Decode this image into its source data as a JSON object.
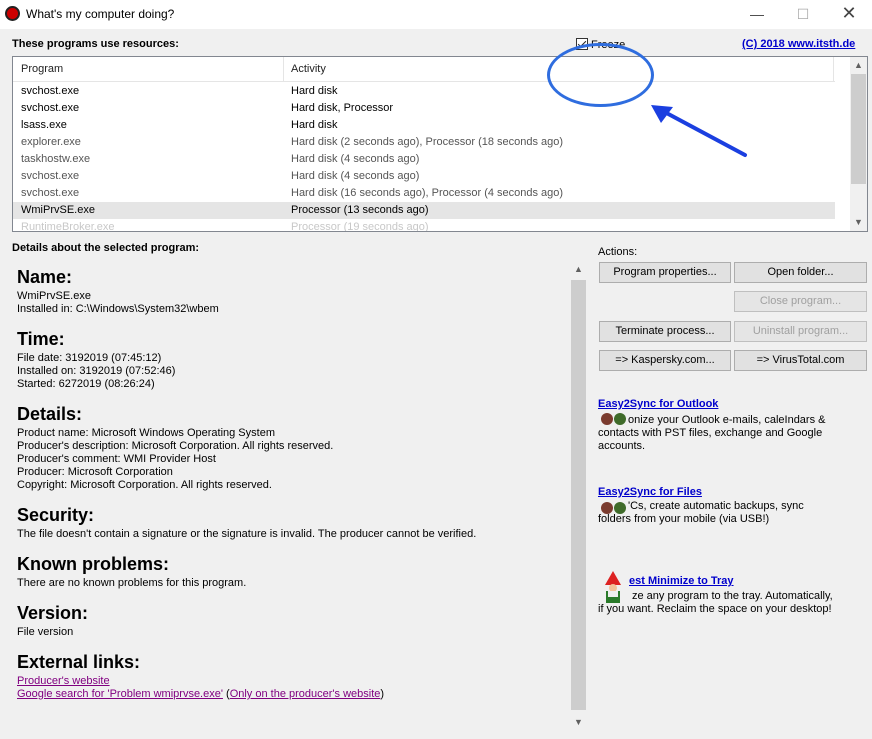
{
  "window": {
    "title": "What's my computer doing?",
    "minimize_glyph": "—",
    "maximize_glyph": "☐",
    "close_glyph": "✕"
  },
  "top": {
    "programs_label": "These programs use resources:",
    "freeze_label": "Freeze",
    "freeze_checked": true,
    "copyright": "(C) 2018 www.itsth.de"
  },
  "list": {
    "columns": [
      "Program",
      "Activity"
    ],
    "rows": [
      {
        "program": "svchost.exe",
        "activity": "Hard disk"
      },
      {
        "program": "svchost.exe",
        "activity": "Hard disk, Processor"
      },
      {
        "program": "lsass.exe",
        "activity": "Hard disk"
      },
      {
        "program": "explorer.exe",
        "activity": "Hard disk (2 seconds ago), Processor (18 seconds ago)"
      },
      {
        "program": "taskhostw.exe",
        "activity": "Hard disk (4 seconds ago)"
      },
      {
        "program": "svchost.exe",
        "activity": "Hard disk (4 seconds ago)"
      },
      {
        "program": "svchost.exe",
        "activity": "Hard disk (16 seconds ago), Processor (4 seconds ago)"
      },
      {
        "program": "WmiPrvSE.exe",
        "activity": "Processor (13 seconds ago)"
      },
      {
        "program": "RuntimeBroker.exe",
        "activity": "Processor (19 seconds ago)"
      }
    ]
  },
  "details": {
    "label": "Details about the selected program:",
    "name_head": "Name:",
    "name_value": "WmiPrvSE.exe",
    "installed_in": "Installed in: C:\\Windows\\System32\\wbem",
    "time_head": "Time:",
    "file_date": "File date: 3192019 (07:45:12)",
    "installed_on": "Installed on: 3192019 (07:52:46)",
    "started": "Started: 6272019 (08:26:24)",
    "details_head": "Details:",
    "product_name": "Product name: Microsoft Windows Operating System",
    "producer_desc": "Producer's description: Microsoft Corporation. All rights reserved.",
    "producer_comment": "Producer's comment: WMI Provider Host",
    "producer": "Producer: Microsoft Corporation",
    "copyright": "Copyright: Microsoft Corporation. All rights reserved.",
    "security_head": "Security:",
    "security_text": "The file doesn't contain a signature or the signature is invalid. The producer cannot be verified.",
    "known_head": "Known problems:",
    "known_text": "There are no known problems for this program.",
    "version_head": "Version:",
    "version_text": "File version",
    "links_head": "External links:",
    "link_producer": "Producer's website",
    "link_google": "Google search for 'Problem wmiprvse.exe'",
    "link_paren_open": " (",
    "link_only_producer": "Only on the producer's website",
    "link_paren_close": ")"
  },
  "actions": {
    "label": "Actions:",
    "program_properties": "Program properties...",
    "open_folder": "Open folder...",
    "close_program": "Close program...",
    "terminate_process": "Terminate process...",
    "uninstall_program": "Uninstall program...",
    "kaspersky": "=> Kaspersky.com...",
    "virustotal": "=> VirusTotal.com"
  },
  "ads": [
    {
      "title": "Easy2Sync for Outlook",
      "text": "onize your Outlook e-mails, caleIndars & contacts with PST files, exchange and Google accounts."
    },
    {
      "title": "Easy2Sync for Files",
      "text": "'Cs, create automatic backups, sync folders from your mobile (via USB!)"
    },
    {
      "title": "est Minimize to Tray",
      "text": "ze any program to the tray. Automatically, if you want. Reclaim the space on your desktop!"
    }
  ],
  "icons": {
    "app": "red-circle-app-icon",
    "checkbox": "checkbox-checked-icon",
    "scroll_up": "▲",
    "scroll_down": "▼"
  },
  "colors": {
    "link_blue": "#0000cc",
    "link_visited": "#800080",
    "annotation_blue": "#2f6ddf",
    "client_bg": "#f0f0f0"
  }
}
